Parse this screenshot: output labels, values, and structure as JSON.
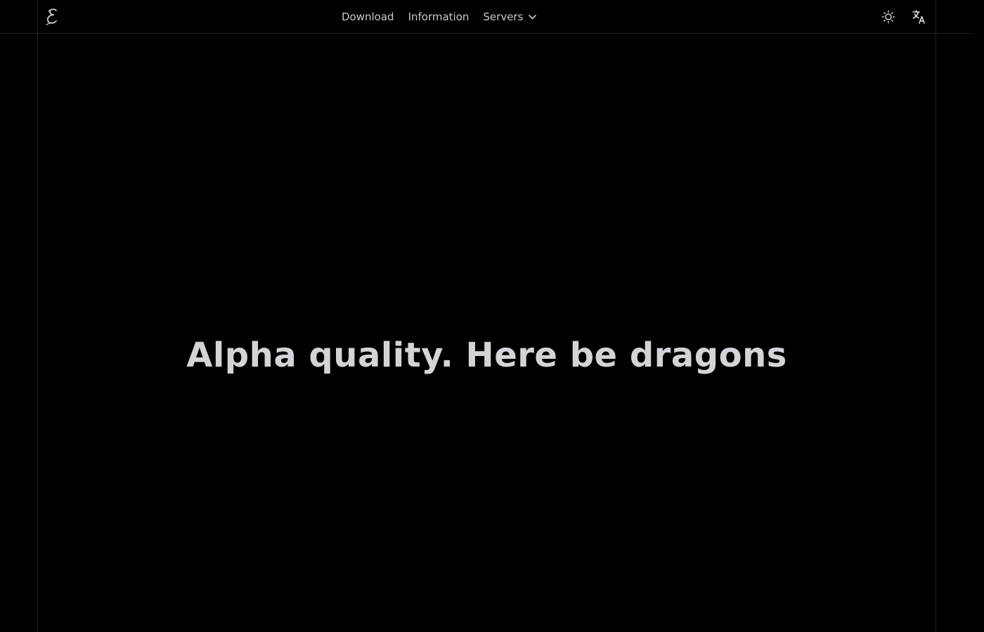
{
  "header": {
    "logo_icon": "script-e-logo-icon",
    "nav": [
      {
        "label": "Download"
      },
      {
        "label": "Information"
      },
      {
        "label": "Servers",
        "icon": "chevron-down-icon"
      }
    ],
    "theme_icon": "sun-icon",
    "language_icon": "translate-icon"
  },
  "main": {
    "headline": "Alpha quality. Here be dragons"
  },
  "colors": {
    "background": "#000000",
    "nav_text": "#c9c9c9",
    "headline_text": "#d4d4d8",
    "divider": "#222222"
  }
}
